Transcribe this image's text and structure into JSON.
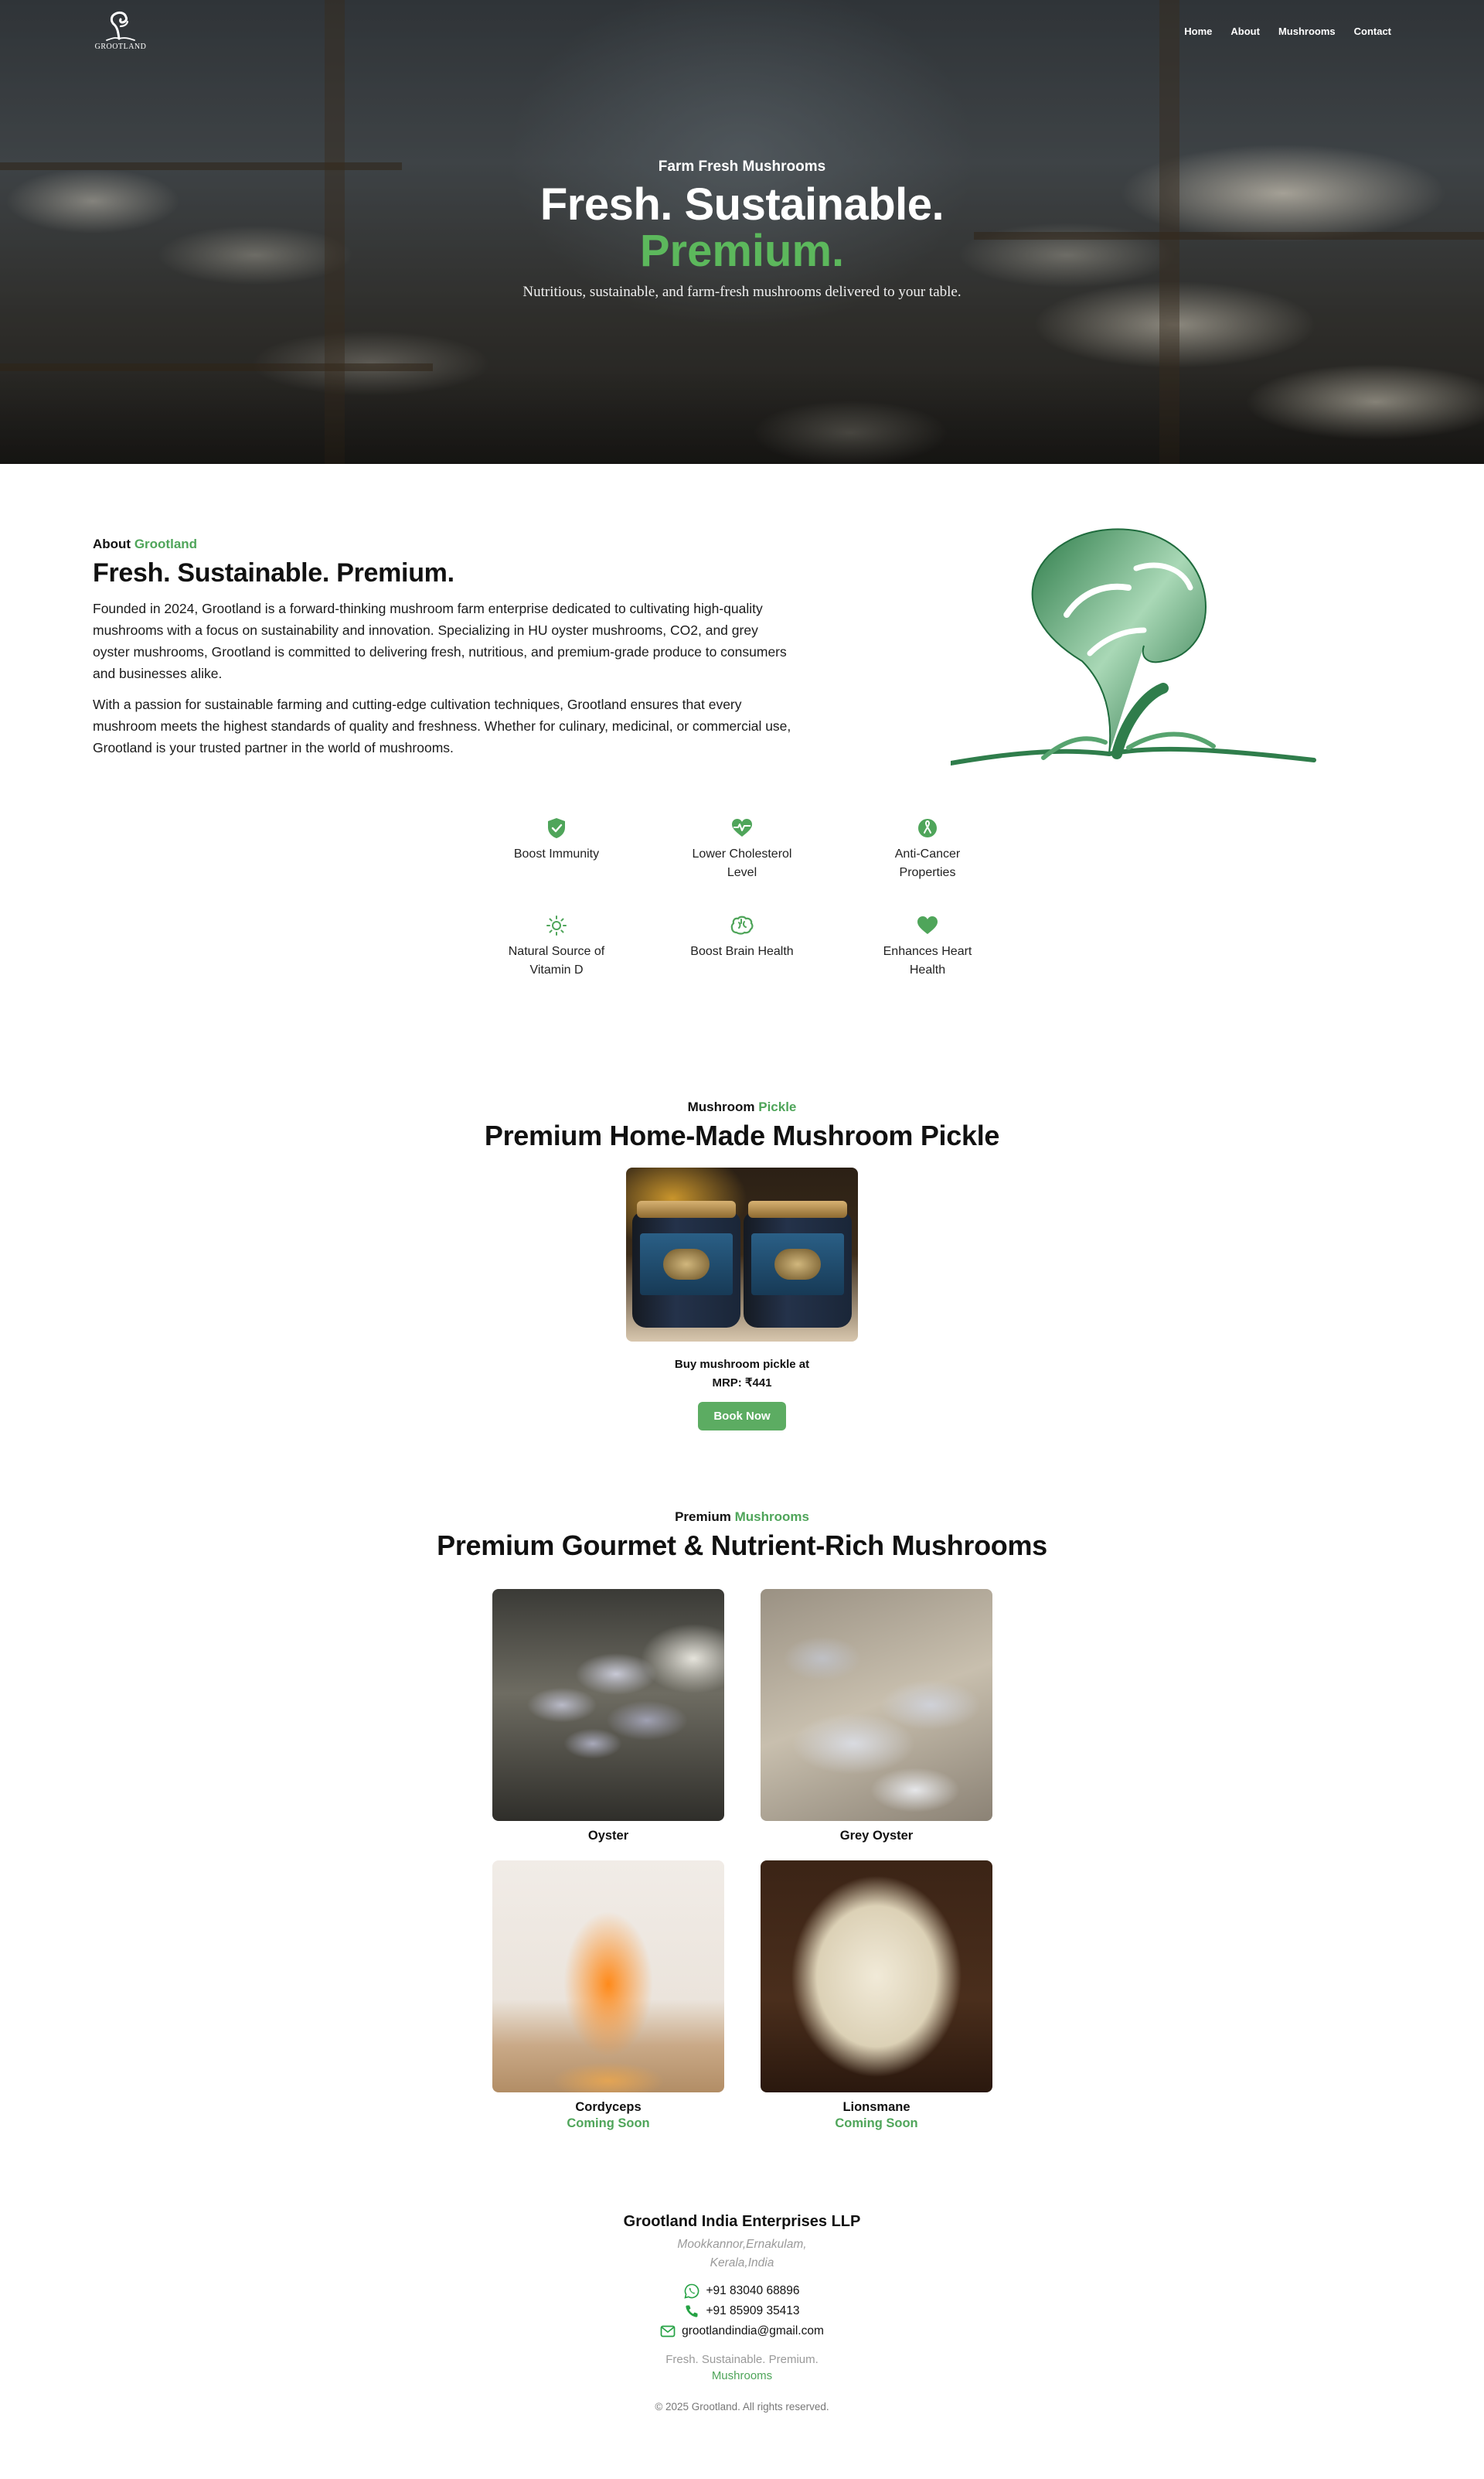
{
  "brand": {
    "name": "GROOTLAND",
    "accent_color": "#5cb85c"
  },
  "nav": {
    "items": [
      {
        "label": "Home"
      },
      {
        "label": "About"
      },
      {
        "label": "Mushrooms"
      },
      {
        "label": "Contact"
      }
    ]
  },
  "hero": {
    "kicker": "Farm Fresh Mushrooms",
    "title": "Fresh. Sustainable.",
    "title_accent": "Premium.",
    "subtitle": "Nutritious, sustainable, and farm-fresh mushrooms delivered to your table."
  },
  "about": {
    "eyebrow": "About",
    "eyebrow_accent": "Grootland",
    "heading": "Fresh. Sustainable. Premium.",
    "paragraphs": [
      "Founded in 2024, Grootland is a forward-thinking mushroom farm enterprise dedicated to cultivating high-quality mushrooms with a focus on sustainability and innovation. Specializing in HU oyster mushrooms, CO2, and grey oyster mushrooms, Grootland is committed to delivering fresh, nutritious, and premium-grade produce to consumers and businesses alike.",
      "With a passion for sustainable farming and cutting-edge cultivation techniques, Grootland ensures that every mushroom meets the highest standards of quality and freshness. Whether for culinary, medicinal, or commercial use, Grootland is your trusted partner in the world of mushrooms."
    ]
  },
  "benefits": [
    {
      "label": "Boost Immunity",
      "icon": "shield-check-icon"
    },
    {
      "label": "Lower Cholesterol Level",
      "icon": "heart-pulse-icon"
    },
    {
      "label": "Anti-Cancer Properties",
      "icon": "ribbon-icon"
    },
    {
      "label": "Natural Source of Vitamin D",
      "icon": "sun-icon"
    },
    {
      "label": "Boost Brain Health",
      "icon": "brain-icon"
    },
    {
      "label": "Enhances Heart Health",
      "icon": "heart-icon"
    }
  ],
  "pickle": {
    "eyebrow": "Mushroom",
    "eyebrow_accent": "Pickle",
    "heading": "Premium Home-Made Mushroom Pickle",
    "buy_line": "Buy mushroom pickle at",
    "price": "MRP: ₹441",
    "button_label": "Book Now"
  },
  "mushrooms": {
    "eyebrow": "Premium",
    "eyebrow_accent": "Mushrooms",
    "heading": "Premium Gourmet & Nutrient-Rich Mushrooms",
    "items": [
      {
        "name": "Oyster",
        "status": ""
      },
      {
        "name": "Grey Oyster",
        "status": ""
      },
      {
        "name": "Cordyceps",
        "status": "Coming Soon"
      },
      {
        "name": "Lionsmane",
        "status": "Coming Soon"
      }
    ]
  },
  "footer": {
    "company": "Grootland India Enterprises LLP",
    "address": "Mookkannor,Ernakulam, Kerala,India",
    "whatsapp": "+91 83040 68896",
    "phone": "+91 85909 35413",
    "email": "grootlandindia@gmail.com",
    "tagline": "Fresh. Sustainable. Premium.",
    "tagline_accent": "Mushrooms",
    "copyright": "© 2025 Grootland. All rights reserved."
  }
}
